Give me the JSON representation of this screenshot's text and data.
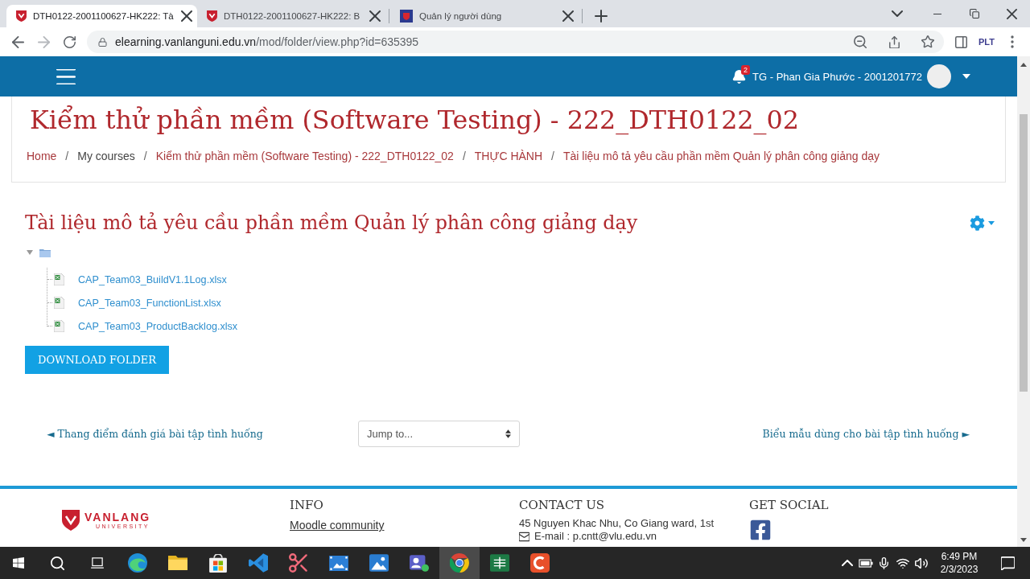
{
  "browser": {
    "tabs": [
      {
        "title": "DTH0122-2001100627-HK222: Tà",
        "kind": "shield",
        "selected": true
      },
      {
        "title": "DTH0122-2001100627-HK222: B",
        "kind": "shield",
        "selected": false
      },
      {
        "title": "Quản lý người dùng",
        "kind": "tile",
        "selected": false
      }
    ],
    "url": {
      "host": "elearning.vanlanguni.edu.vn",
      "path": "/mod/folder/view.php?id=635395"
    },
    "forward_disabled": true,
    "extension_label": "PLT"
  },
  "navbar": {
    "notification_count": "2",
    "user_name": "TG - Phan Gia Phước - 2001201772"
  },
  "page_header": {
    "title": "Kiểm thử phần mềm (Software Testing) - 222_DTH0122_02",
    "breadcrumb": [
      {
        "label": "Home",
        "kind": "link"
      },
      {
        "label": "My courses",
        "kind": "text",
        "separator": "/"
      },
      {
        "label": "Kiểm thử phần mềm (Software Testing) - 222_DTH0122_02",
        "kind": "link",
        "separator": "/"
      },
      {
        "label": "THỰC HÀNH",
        "kind": "link",
        "separator": "/"
      },
      {
        "label": "Tài liệu mô tả yêu cầu phần mềm Quản lý phân công giảng dạy",
        "kind": "link",
        "separator": "/"
      }
    ]
  },
  "main": {
    "heading": "Tài liệu mô tả yêu cầu phần mềm Quản lý phân công giảng dạy",
    "folder": {
      "expanded": true,
      "files": [
        "CAP_Team03_BuildV1.1Log.xlsx",
        "CAP_Team03_FunctionList.xlsx",
        "CAP_Team03_ProductBacklog.xlsx"
      ]
    },
    "download_button": "DOWNLOAD FOLDER"
  },
  "activity_nav": {
    "previous": "◄ Thang điểm đánh giá bài tập tình huống",
    "jump_select": "Jump to...",
    "next": "Biểu mẫu dùng cho bài tập tình huống ►"
  },
  "footer": {
    "logo": {
      "name": "VANLANG",
      "tagline": "UNIVERSITY"
    },
    "columns": [
      {
        "heading": "INFO",
        "kind": "links",
        "items": [
          {
            "kind": "link",
            "text": "Moodle community"
          }
        ]
      },
      {
        "heading": "CONTACT US",
        "kind": "contact",
        "items": [
          {
            "kind": "address",
            "text": "45 Nguyen Khac Nhu, Co Giang ward, 1st"
          },
          {
            "kind": "email",
            "text": "E-mail : p.cntt@vlu.edu.vn"
          }
        ]
      },
      {
        "heading": "GET SOCIAL",
        "kind": "social",
        "items": [
          {
            "kind": "facebook"
          }
        ]
      }
    ]
  },
  "taskbar": {
    "apps": [
      {
        "kind": "edge",
        "active": false
      },
      {
        "kind": "explorer",
        "active": false
      },
      {
        "kind": "store",
        "active": false
      },
      {
        "kind": "editor",
        "active": false
      },
      {
        "kind": "snipping",
        "active": false
      },
      {
        "kind": "video",
        "active": false
      },
      {
        "kind": "photos",
        "active": false
      },
      {
        "kind": "teams",
        "active": false
      },
      {
        "kind": "chrome",
        "active": true
      },
      {
        "kind": "excel",
        "active": false
      },
      {
        "kind": "recorder",
        "active": false
      }
    ],
    "time": "6:49 PM",
    "date": "2/3/2023"
  }
}
